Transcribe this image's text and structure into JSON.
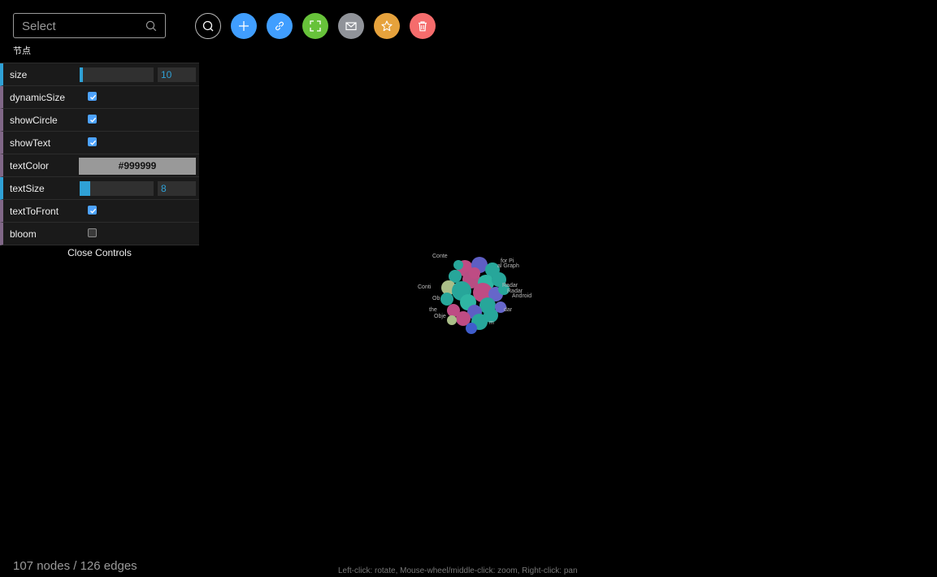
{
  "search": {
    "placeholder": "Select",
    "icon": "search-icon"
  },
  "toolbar": [
    {
      "name": "search-tool-button",
      "icon": "search-icon",
      "color": "#000000",
      "border": "#bbbbbb"
    },
    {
      "name": "add-button",
      "icon": "plus-icon",
      "color": "#409eff"
    },
    {
      "name": "link-button",
      "icon": "link-icon",
      "color": "#409eff"
    },
    {
      "name": "fullscreen-button",
      "icon": "fullscreen-icon",
      "color": "#67c23a"
    },
    {
      "name": "message-button",
      "icon": "mail-icon",
      "color": "#909399"
    },
    {
      "name": "favorite-button",
      "icon": "star-icon",
      "color": "#e6a23c"
    },
    {
      "name": "delete-button",
      "icon": "trash-icon",
      "color": "#f56c6c"
    }
  ],
  "controls": {
    "folder": "节点",
    "size": {
      "label": "size",
      "value": "10",
      "fill": 0.04
    },
    "dynamicSize": {
      "label": "dynamicSize",
      "checked": true
    },
    "showCircle": {
      "label": "showCircle",
      "checked": true
    },
    "showText": {
      "label": "showText",
      "checked": true
    },
    "textColor": {
      "label": "textColor",
      "value": "#999999"
    },
    "textSize": {
      "label": "textSize",
      "value": "8",
      "fill": 0.14
    },
    "textToFront": {
      "label": "textToFront",
      "checked": true
    },
    "bloom": {
      "label": "bloom",
      "checked": false
    },
    "close_label": "Close Controls"
  },
  "graph": {
    "labels": [
      "Conte",
      "for Pi",
      "al Graph",
      "Radar",
      "Radar",
      "Android",
      "dar",
      "Conti",
      "the",
      "Obje",
      "m",
      "Ob"
    ]
  },
  "stats": {
    "nodes": "107 nodes",
    "separator": "/",
    "edges": "126 edges"
  },
  "hint": "Left-click: rotate, Mouse-wheel/middle-click: zoom, Right-click: pan"
}
